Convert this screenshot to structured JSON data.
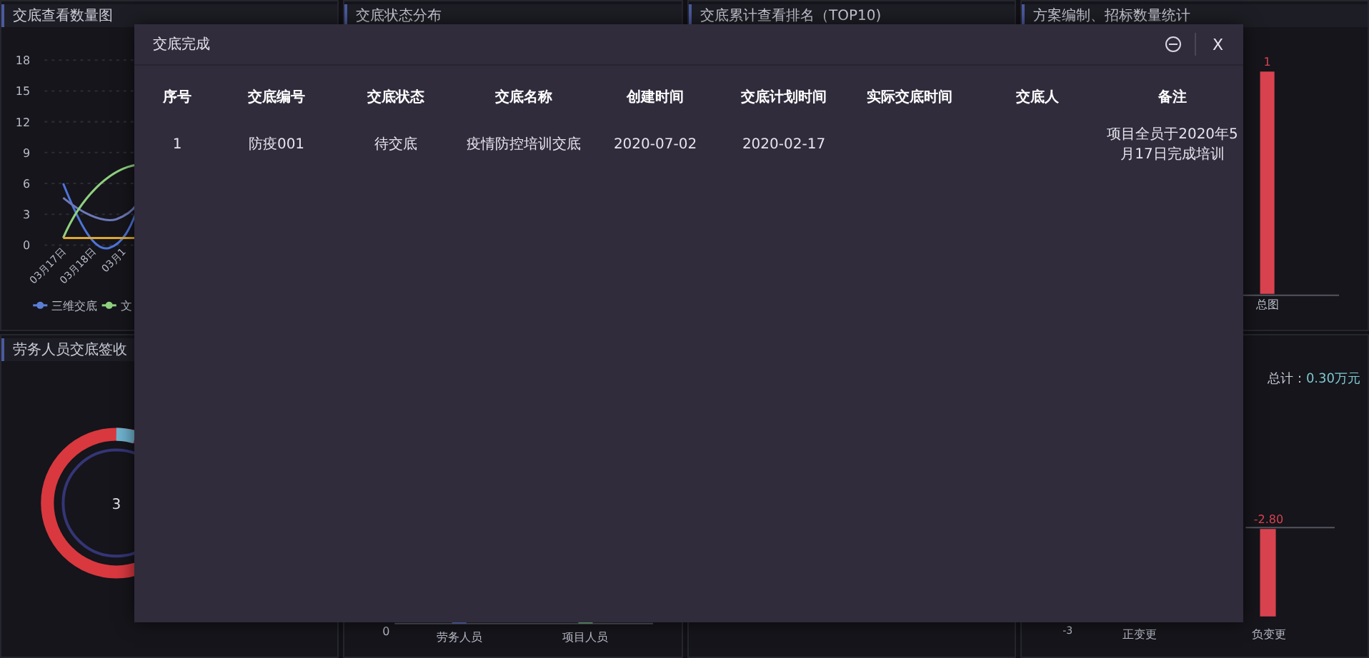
{
  "panels": [
    {
      "kind": "line",
      "title": "交底查看数量图",
      "y_ticks": [
        "18",
        "15",
        "12",
        "9",
        "6",
        "3",
        "0"
      ],
      "x_labels": [
        "03月17日",
        "03月18日",
        "03月1"
      ],
      "legend": [
        {
          "label": "三维交底",
          "color": "#5b7fd6"
        },
        {
          "label": "文",
          "color": "#8fd17f"
        }
      ]
    },
    {
      "kind": "blank",
      "title": "交底状态分布"
    },
    {
      "kind": "blank",
      "title": "交底累计查看排名（TOP10)"
    },
    {
      "kind": "bar",
      "title": "方案编制、招标数量统计",
      "bar_value": "1",
      "bar_label": "总图"
    },
    {
      "kind": "donut",
      "title": "劳务人员交底签收",
      "center": "3"
    },
    {
      "kind": "axis",
      "zero": "0",
      "labels": [
        "劳务人员",
        "项目人员"
      ]
    },
    {
      "kind": "blank"
    },
    {
      "kind": "change",
      "total_label": "总计：",
      "total_value": "0.30万元",
      "bar_value": "-2.80",
      "tick": "-3",
      "labels": [
        "正变更",
        "负变更"
      ]
    }
  ],
  "modal": {
    "title": "交底完成",
    "close": "X",
    "columns": [
      "序号",
      "交底编号",
      "交底状态",
      "交底名称",
      "创建时间",
      "交底计划时间",
      "实际交底时间",
      "交底人",
      "备注"
    ],
    "rows": [
      {
        "index": "1",
        "code": "防疫001",
        "status": "待交底",
        "name": "疫情防控培训交底",
        "created": "2020-07-02",
        "planned": "2020-02-17",
        "note": "项目全员于2020年5月17日完成培训"
      }
    ]
  }
}
